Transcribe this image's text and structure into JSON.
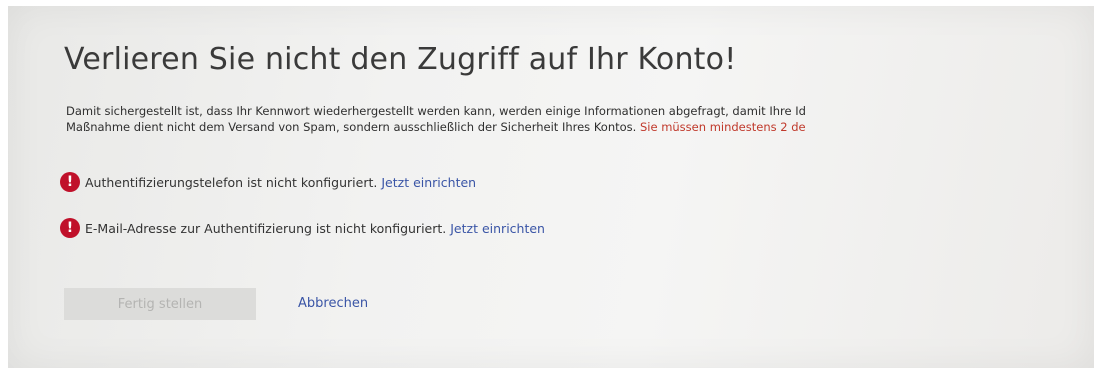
{
  "dialog": {
    "title": "Verlieren Sie nicht den Zugriff auf Ihr Konto!",
    "description": {
      "line1": "Damit sichergestellt ist, dass Ihr Kennwort wiederhergestellt werden kann, werden einige Informationen abgefragt, damit Ihre Id",
      "line2_normal": "Maßnahme dient nicht dem Versand von Spam, sondern ausschließlich der Sicherheit Ihres Kontos.",
      "line2_warning": "Sie müssen mindestens 2 de"
    },
    "status_items": [
      {
        "icon": "error-icon",
        "icon_glyph": "!",
        "text": "Authentifizierungstelefon ist nicht konfiguriert.",
        "link": "Jetzt einrichten"
      },
      {
        "icon": "error-icon",
        "icon_glyph": "!",
        "text": "E-Mail-Adresse zur Authentifizierung ist nicht konfiguriert.",
        "link": "Jetzt einrichten"
      }
    ],
    "buttons": {
      "finish": "Fertig stellen",
      "cancel": "Abbrechen"
    }
  }
}
